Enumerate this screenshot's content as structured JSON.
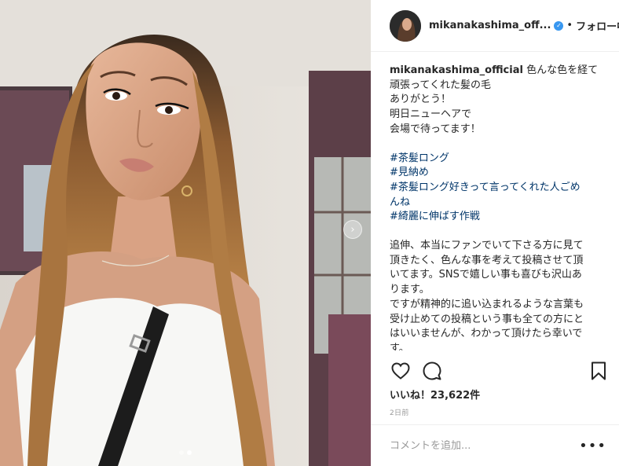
{
  "post": {
    "username": "mikanakashima_official",
    "header_username": "mikanakashima_off...",
    "header_separator": "•",
    "follow_label": "フォロー中",
    "caption_lines": [
      "色んな色を経て",
      "頑張ってくれた髪の毛",
      "ありがとう！",
      "明日ニューヘアで",
      "会場で待ってます！"
    ],
    "hashtags": [
      "#茶髪ロング",
      "#見納め",
      "#茶髪ロング好きって言ってくれた人ごめ",
      "んね",
      "#綺麗に伸ばす作戦"
    ],
    "postscript_lines": [
      "追伸、本当にファンでいて下さる方に見て",
      "頂きたく、色んな事を考えて投稿させて頂",
      "いてます。SNSで嬉しい事も喜びも沢山あ",
      "ります。",
      "ですが精神的に追い込まれるような言葉も",
      "受け止めての投稿という事も全ての方にと",
      "はいいませんが、わかって頂けたら幸いで",
      "す。"
    ],
    "likes_text": "いいね！23,622件",
    "timestamp": "2日前",
    "comment_placeholder": "コメントを追加...",
    "more_label": "•••"
  },
  "icons": {
    "like": "heart-icon",
    "comment": "comment-icon",
    "save": "bookmark-icon",
    "verified": "verified-badge-icon",
    "next": "chevron-right-icon"
  },
  "carousel": {
    "count": 2,
    "active_index": 1
  },
  "colors": {
    "verified": "#3897f0",
    "hashtag": "#003569",
    "text": "#262626",
    "muted": "#999999"
  }
}
